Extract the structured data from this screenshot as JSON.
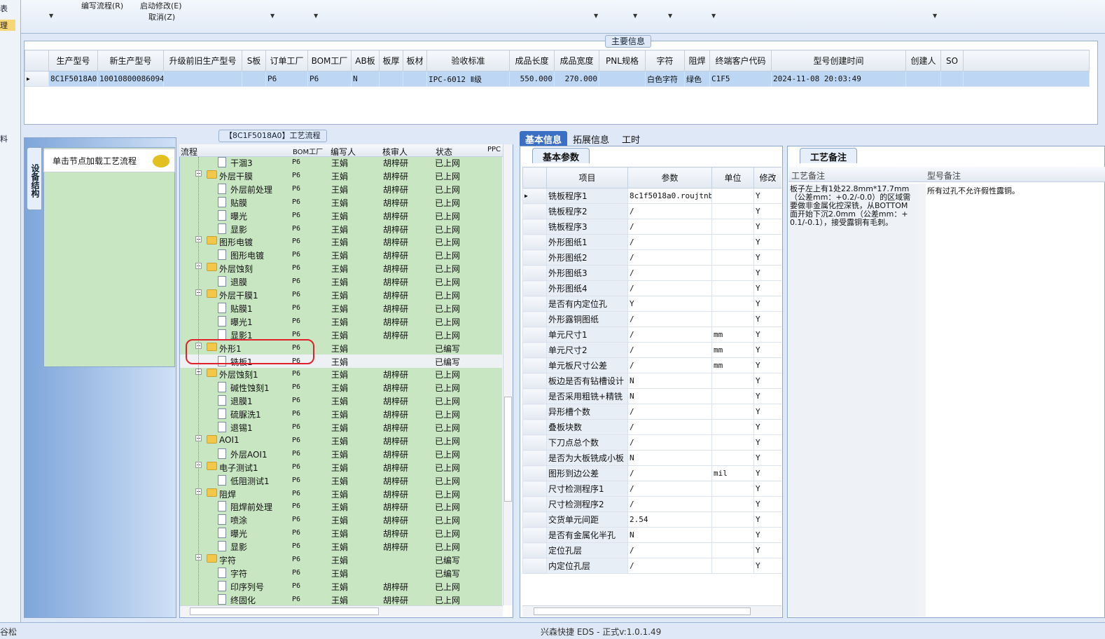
{
  "left_strip": {
    "chars": [
      "表",
      "理",
      "料"
    ]
  },
  "menu": {
    "edit_flow": "编写流程(R)",
    "start_modify": "启动修改(E)",
    "cancel": "取消(Z)"
  },
  "main_info": {
    "title": "主要信息",
    "columns": [
      "生产型号",
      "新生产型号",
      "升级前旧生产型号",
      "S板",
      "订单工厂",
      "BOM工厂",
      "AB板",
      "板厚",
      "板材",
      "验收标准",
      "成品长度",
      "成品宽度",
      "PNL规格",
      "字符",
      "阻焊",
      "终端客户代码",
      "型号创建时间",
      "创建人",
      "SO"
    ],
    "row": [
      "8C1F5018A0",
      "10010800086094",
      "",
      "",
      "P6",
      "P6",
      "N",
      "",
      "",
      "IPC-6012 Ⅱ级",
      "550.000",
      "270.000",
      "",
      "白色字符",
      "绿色",
      "C1F5",
      "2024-11-08 20:03:49",
      "",
      ""
    ]
  },
  "process": {
    "title": "【8C1F5018A0】工艺流程",
    "vtab": "设备结构",
    "load_hint": "单击节点加载工艺流程",
    "columns": [
      "流程",
      "BOM工厂",
      "编写人",
      "核审人",
      "状态",
      "PPC"
    ],
    "rows": [
      {
        "name": "干涸3",
        "level": 1,
        "bom": "P6",
        "writer": "王娟",
        "reviewer": "胡梓研",
        "status": "已上网"
      },
      {
        "name": "外层干膜",
        "level": 0,
        "bom": "P6",
        "writer": "王娟",
        "reviewer": "胡梓研",
        "status": "已上网"
      },
      {
        "name": "外层前处理",
        "level": 1,
        "bom": "P6",
        "writer": "王娟",
        "reviewer": "胡梓研",
        "status": "已上网"
      },
      {
        "name": "贴膜",
        "level": 1,
        "bom": "P6",
        "writer": "王娟",
        "reviewer": "胡梓研",
        "status": "已上网"
      },
      {
        "name": "曝光",
        "level": 1,
        "bom": "P6",
        "writer": "王娟",
        "reviewer": "胡梓研",
        "status": "已上网"
      },
      {
        "name": "显影",
        "level": 1,
        "bom": "P6",
        "writer": "王娟",
        "reviewer": "胡梓研",
        "status": "已上网"
      },
      {
        "name": "图形电镀",
        "level": 0,
        "bom": "P6",
        "writer": "王娟",
        "reviewer": "胡梓研",
        "status": "已上网"
      },
      {
        "name": "图形电镀",
        "level": 1,
        "bom": "P6",
        "writer": "王娟",
        "reviewer": "胡梓研",
        "status": "已上网"
      },
      {
        "name": "外层蚀刻",
        "level": 0,
        "bom": "P6",
        "writer": "王娟",
        "reviewer": "胡梓研",
        "status": "已上网"
      },
      {
        "name": "退膜",
        "level": 1,
        "bom": "P6",
        "writer": "王娟",
        "reviewer": "胡梓研",
        "status": "已上网"
      },
      {
        "name": "外层干膜1",
        "level": 0,
        "bom": "P6",
        "writer": "王娟",
        "reviewer": "胡梓研",
        "status": "已上网"
      },
      {
        "name": "贴膜1",
        "level": 1,
        "bom": "P6",
        "writer": "王娟",
        "reviewer": "胡梓研",
        "status": "已上网"
      },
      {
        "name": "曝光1",
        "level": 1,
        "bom": "P6",
        "writer": "王娟",
        "reviewer": "胡梓研",
        "status": "已上网"
      },
      {
        "name": "显影1",
        "level": 1,
        "bom": "P6",
        "writer": "王娟",
        "reviewer": "胡梓研",
        "status": "已上网"
      },
      {
        "name": "外形1",
        "level": 0,
        "bom": "P6",
        "writer": "王娟",
        "reviewer": "",
        "status": "已编写"
      },
      {
        "name": "铣板1",
        "level": 1,
        "bom": "P6",
        "writer": "王娟",
        "reviewer": "",
        "status": "已编写",
        "selected": true
      },
      {
        "name": "外层蚀刻1",
        "level": 0,
        "bom": "P6",
        "writer": "王娟",
        "reviewer": "胡梓研",
        "status": "已上网"
      },
      {
        "name": "碱性蚀刻1",
        "level": 1,
        "bom": "P6",
        "writer": "王娟",
        "reviewer": "胡梓研",
        "status": "已上网"
      },
      {
        "name": "退膜1",
        "level": 1,
        "bom": "P6",
        "writer": "王娟",
        "reviewer": "胡梓研",
        "status": "已上网"
      },
      {
        "name": "硫脲洗1",
        "level": 1,
        "bom": "P6",
        "writer": "王娟",
        "reviewer": "胡梓研",
        "status": "已上网"
      },
      {
        "name": "退锡1",
        "level": 1,
        "bom": "P6",
        "writer": "王娟",
        "reviewer": "胡梓研",
        "status": "已上网"
      },
      {
        "name": "AOI1",
        "level": 0,
        "bom": "P6",
        "writer": "王娟",
        "reviewer": "胡梓研",
        "status": "已上网"
      },
      {
        "name": "外层AOI1",
        "level": 1,
        "bom": "P6",
        "writer": "王娟",
        "reviewer": "胡梓研",
        "status": "已上网"
      },
      {
        "name": "电子测试1",
        "level": 0,
        "bom": "P6",
        "writer": "王娟",
        "reviewer": "胡梓研",
        "status": "已上网"
      },
      {
        "name": "低阻测试1",
        "level": 1,
        "bom": "P6",
        "writer": "王娟",
        "reviewer": "胡梓研",
        "status": "已上网"
      },
      {
        "name": "阻焊",
        "level": 0,
        "bom": "P6",
        "writer": "王娟",
        "reviewer": "胡梓研",
        "status": "已上网"
      },
      {
        "name": "阻焊前处理",
        "level": 1,
        "bom": "P6",
        "writer": "王娟",
        "reviewer": "胡梓研",
        "status": "已上网"
      },
      {
        "name": "喷涂",
        "level": 1,
        "bom": "P6",
        "writer": "王娟",
        "reviewer": "胡梓研",
        "status": "已上网"
      },
      {
        "name": "曝光",
        "level": 1,
        "bom": "P6",
        "writer": "王娟",
        "reviewer": "胡梓研",
        "status": "已上网"
      },
      {
        "name": "显影",
        "level": 1,
        "bom": "P6",
        "writer": "王娟",
        "reviewer": "胡梓研",
        "status": "已上网"
      },
      {
        "name": "字符",
        "level": 0,
        "bom": "P6",
        "writer": "王娟",
        "reviewer": "",
        "status": "已编写"
      },
      {
        "name": "字符",
        "level": 1,
        "bom": "P6",
        "writer": "王娟",
        "reviewer": "",
        "status": "已编写"
      },
      {
        "name": "印序列号",
        "level": 1,
        "bom": "P6",
        "writer": "王娟",
        "reviewer": "胡梓研",
        "status": "已上网"
      },
      {
        "name": "终固化",
        "level": 1,
        "bom": "P6",
        "writer": "王娟",
        "reviewer": "胡梓研",
        "status": "已上网"
      }
    ]
  },
  "tabs": [
    "基本信息",
    "拓展信息",
    "工时"
  ],
  "params": {
    "title": "基本参数",
    "columns": [
      "项目",
      "参数",
      "单位",
      "修改"
    ],
    "rows": [
      {
        "item": "铣板程序1",
        "value": "8c1f5018a0.roujtnb",
        "unit": "",
        "mod": "Y"
      },
      {
        "item": "铣板程序2",
        "value": "/",
        "unit": "",
        "mod": "Y"
      },
      {
        "item": "铣板程序3",
        "value": "/",
        "unit": "",
        "mod": "Y"
      },
      {
        "item": "外形图纸1",
        "value": "/",
        "unit": "",
        "mod": "Y"
      },
      {
        "item": "外形图纸2",
        "value": "/",
        "unit": "",
        "mod": "Y"
      },
      {
        "item": "外形图纸3",
        "value": "/",
        "unit": "",
        "mod": "Y"
      },
      {
        "item": "外形图纸4",
        "value": "/",
        "unit": "",
        "mod": "Y"
      },
      {
        "item": "是否有内定位孔",
        "value": "Y",
        "unit": "",
        "mod": "Y"
      },
      {
        "item": "外形露铜图纸",
        "value": "/",
        "unit": "",
        "mod": "Y"
      },
      {
        "item": "单元尺寸1",
        "value": "/",
        "unit": "mm",
        "mod": "Y"
      },
      {
        "item": "单元尺寸2",
        "value": "/",
        "unit": "mm",
        "mod": "Y"
      },
      {
        "item": "单元板尺寸公差",
        "value": "/",
        "unit": "mm",
        "mod": "Y"
      },
      {
        "item": "板边是否有钻槽设计",
        "value": "N",
        "unit": "",
        "mod": "Y"
      },
      {
        "item": "是否采用粗铣+精铣",
        "value": "N",
        "unit": "",
        "mod": "Y"
      },
      {
        "item": "异形槽个数",
        "value": "/",
        "unit": "",
        "mod": "Y"
      },
      {
        "item": "叠板块数",
        "value": "/",
        "unit": "",
        "mod": "Y"
      },
      {
        "item": "下刀点总个数",
        "value": "/",
        "unit": "",
        "mod": "Y"
      },
      {
        "item": "是否为大板铣成小板",
        "value": "N",
        "unit": "",
        "mod": "Y"
      },
      {
        "item": "图形到边公差",
        "value": "/",
        "unit": "mil",
        "mod": "Y"
      },
      {
        "item": "尺寸检测程序1",
        "value": "/",
        "unit": "",
        "mod": "Y"
      },
      {
        "item": "尺寸检测程序2",
        "value": "/",
        "unit": "",
        "mod": "Y"
      },
      {
        "item": "交货单元间距",
        "value": "2.54",
        "unit": "",
        "mod": "Y"
      },
      {
        "item": "是否有金属化半孔",
        "value": "N",
        "unit": "",
        "mod": "Y"
      },
      {
        "item": "定位孔层",
        "value": "/",
        "unit": "",
        "mod": "Y"
      },
      {
        "item": "内定位孔层",
        "value": "/",
        "unit": "",
        "mod": "Y"
      }
    ]
  },
  "remarks": {
    "title": "工艺备注",
    "col1_header": "工艺备注",
    "col2_header": "型号备注",
    "process_note": "板子左上有1处22.8mm*17.7mm（公差mm：+0.2/-0.0）的区域需要做非金属化控深铣，从BOTTOM面开始下沉2.0mm（公差mm：+0.1/-0.1），接受露铜有毛刺。",
    "model_note": "所有过孔不允许假性露铜。"
  },
  "status": {
    "user": "谷松",
    "app": "兴森快捷 EDS - 正式v:1.0.1.49"
  }
}
